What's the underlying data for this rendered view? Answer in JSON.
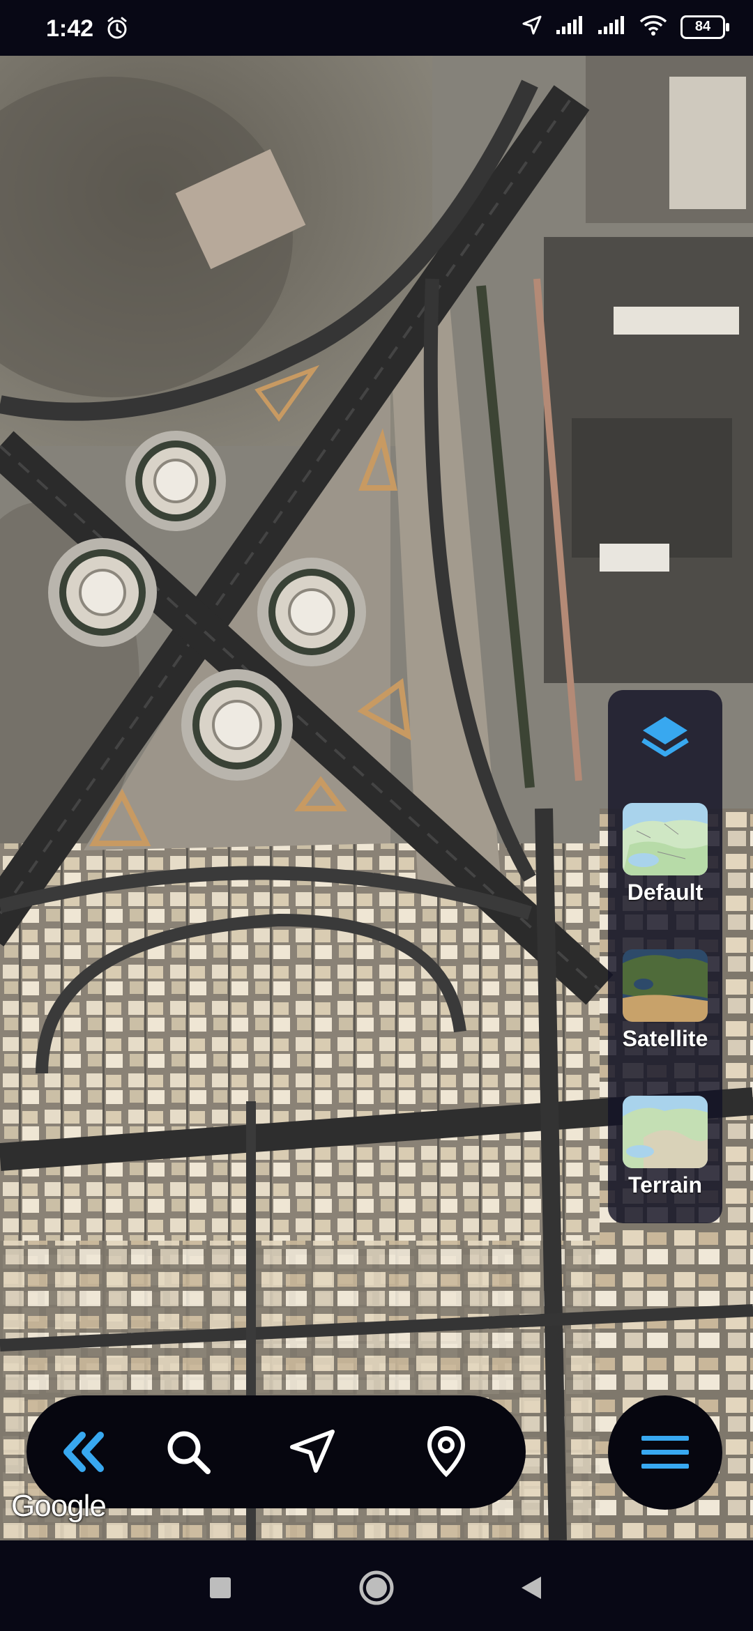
{
  "status_bar": {
    "time": "1:42",
    "battery": "84",
    "icons": [
      "alarm-icon",
      "location-arrow-icon",
      "signal-icon",
      "signal-icon",
      "wifi-icon",
      "battery-icon"
    ]
  },
  "map": {
    "attribution": "Google",
    "type": "satellite"
  },
  "layers": {
    "icon": "layers-icon",
    "accent": "#38a8f0",
    "options": [
      {
        "label": "Default"
      },
      {
        "label": "Satellite"
      },
      {
        "label": "Terrain"
      }
    ]
  },
  "bottom_bar": {
    "buttons": [
      "double-chevron-left-icon",
      "search-icon",
      "navigation-arrow-icon",
      "map-pin-icon"
    ],
    "accent": "#38a8f0"
  },
  "menu_button": {
    "icon": "hamburger-menu-icon"
  },
  "nav_bar": {
    "buttons": [
      "recent-apps-icon",
      "home-icon",
      "back-icon"
    ]
  }
}
